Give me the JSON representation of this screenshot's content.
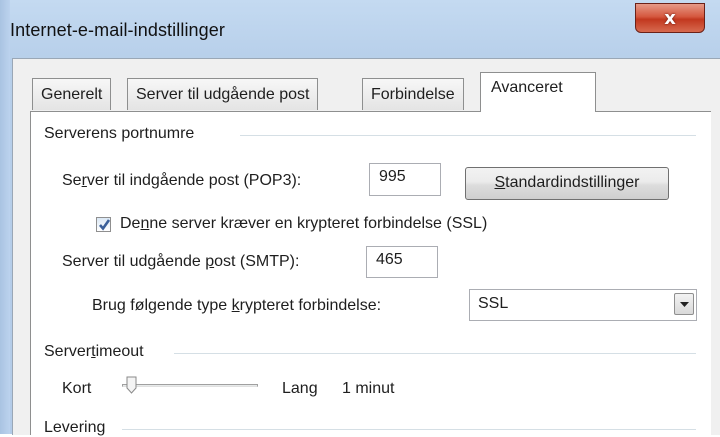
{
  "window": {
    "title": "Internet-e-mail-indstillinger",
    "close_glyph": "x"
  },
  "tabs": [
    {
      "label": "Generelt",
      "active": false
    },
    {
      "label": "Server til udgående post",
      "active": false
    },
    {
      "label": "Forbindelse",
      "active": false
    },
    {
      "label": "Avanceret",
      "active": true
    }
  ],
  "ports_group": {
    "title": "Serverens portnumre",
    "incoming_label_pre": "Se",
    "incoming_label_ul": "r",
    "incoming_label_post": "ver til indgående post (POP3):",
    "incoming_value": "995",
    "default_button_ul": "S",
    "default_button_post": "tandardindstillinger",
    "ssl_check_pre": "De",
    "ssl_check_ul": "n",
    "ssl_check_post": "ne server kræver en krypteret forbindelse (SSL)",
    "ssl_checked": true,
    "outgoing_label_pre": "Server til udgående ",
    "outgoing_label_ul": "p",
    "outgoing_label_post": "ost (SMTP):",
    "outgoing_value": "465",
    "encryption_label_pre": "Brug følgende type ",
    "encryption_label_ul": "k",
    "encryption_label_post": "rypteret forbindelse:",
    "encryption_value": "SSL"
  },
  "timeout_group": {
    "title_pre": "Server",
    "title_ul": "t",
    "title_post": "imeout",
    "short_label": "Kort",
    "long_label": "Lang",
    "timeout_value": "1 minut",
    "slider_level": 0.0
  },
  "delivery_group": {
    "title": "Levering"
  },
  "icons": {
    "close": "close-icon",
    "checkmark": "checkmark-icon",
    "dropdown": "chevron-down-icon",
    "slider_thumb": "slider-thumb-icon"
  },
  "colors": {
    "title_bar": "#b7cfea",
    "close_button": "#c7432a",
    "tab_page": "#ffffff",
    "dialog_face": "#f0f0f0"
  }
}
